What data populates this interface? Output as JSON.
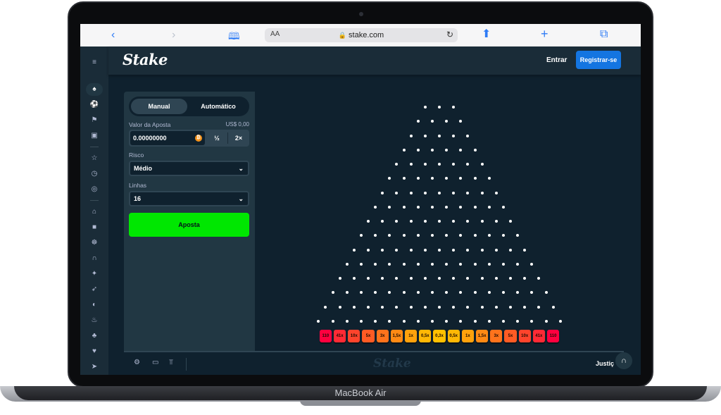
{
  "device": {
    "label": "MacBook Air"
  },
  "browser": {
    "url": "stake.com",
    "aa_label": "AA",
    "icons": [
      "chevron-left-icon",
      "chevron-right-icon",
      "book-icon",
      "lock-icon",
      "reload-icon",
      "share-icon",
      "plus-icon",
      "tabs-icon"
    ]
  },
  "header": {
    "logo": "Stake",
    "login_label": "Entrar",
    "register_label": "Registrar-se",
    "register_color": "#1475e1"
  },
  "rail": {
    "icons": [
      "menu-icon",
      "casino-icon",
      "sports-icon",
      "promotions-icon",
      "chest-icon",
      "star-icon",
      "clock-icon",
      "spinner-icon",
      "home-icon",
      "bookmark-icon",
      "multiplayer-icon",
      "headset-icon",
      "gift-icon",
      "rocket-icon",
      "globe-icon",
      "fire-icon",
      "slots-icon",
      "table-games-icon",
      "crypto-icon"
    ]
  },
  "game": {
    "tabs": {
      "manual": "Manual",
      "auto": "Automático"
    },
    "bet_amount_label": "Valor da Aposta",
    "bet_amount_fiat": "US$ 0,00",
    "bet_amount_value": "0.00000000",
    "coin_symbol": "₿",
    "half_label": "½",
    "double_label": "2×",
    "risk_label": "Risco",
    "risk_value": "Médio",
    "rows_label": "Linhas",
    "rows_value": "16",
    "bet_button": "Aposta",
    "bet_button_color": "#00e701"
  },
  "plinko": {
    "rows": 16,
    "multipliers": [
      "110",
      "41x",
      "10x",
      "5x",
      "3x",
      "1,5x",
      "1x",
      "0,5x",
      "0,3x",
      "0,5x",
      "1x",
      "1,5x",
      "3x",
      "5x",
      "10x",
      "41x",
      "110"
    ],
    "bucket_colors": [
      "#ff003f",
      "#ff2a35",
      "#ff442c",
      "#ff5b24",
      "#ff731c",
      "#ff8a14",
      "#ffa20c",
      "#ffb805",
      "#ffc000",
      "#ffb805",
      "#ffa20c",
      "#ff8a14",
      "#ff731c",
      "#ff5b24",
      "#ff442c",
      "#ff2a35",
      "#ff003f"
    ]
  },
  "footer": {
    "logo": "Stake",
    "fairness_label": "Justiç",
    "icons": [
      "settings-icon",
      "theatre-mode-icon",
      "stats-icon",
      "headset-icon"
    ]
  }
}
